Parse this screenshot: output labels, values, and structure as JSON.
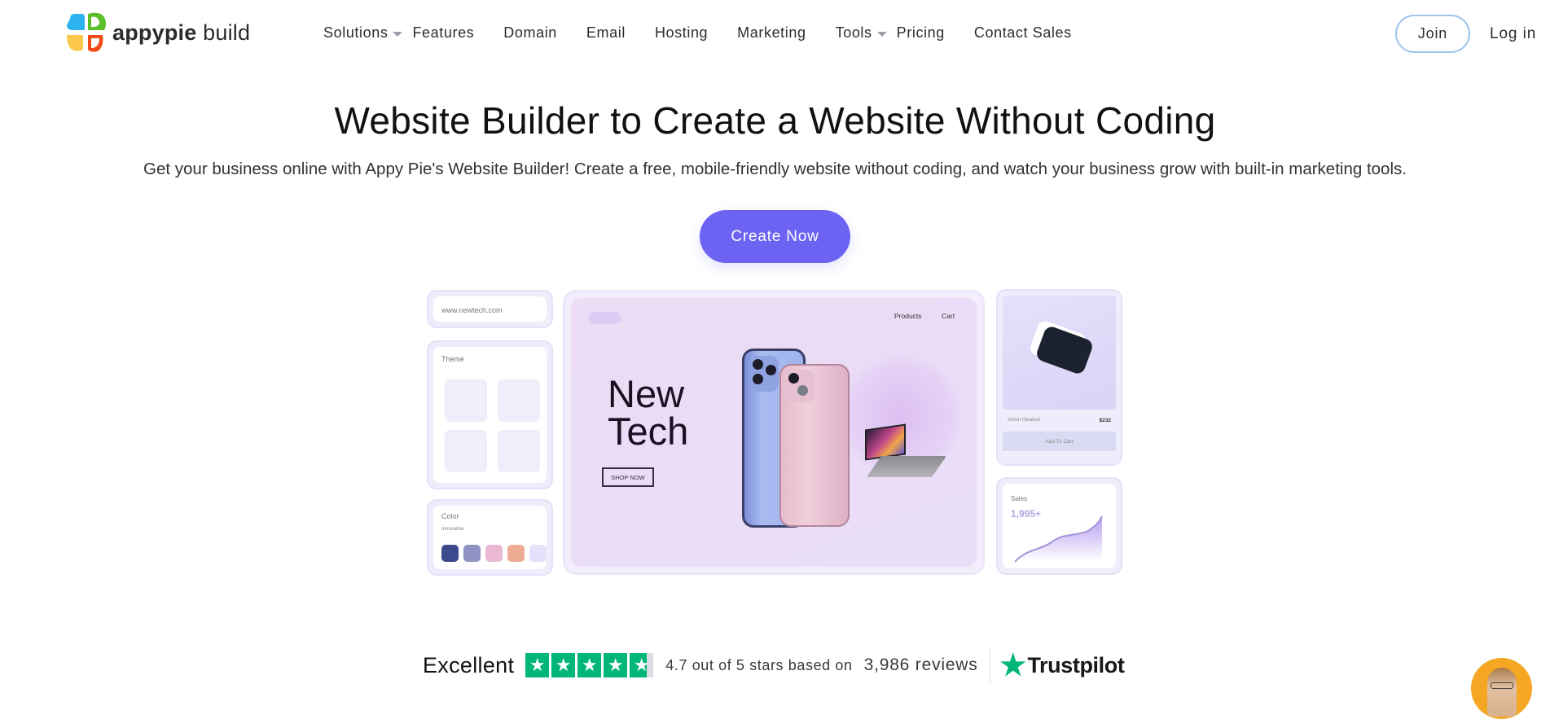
{
  "header": {
    "logo": {
      "brand_bold": "appypie",
      "brand_light": "build",
      "icon": "appypie-logo-icon"
    },
    "nav": [
      {
        "label": "Solutions",
        "has_dropdown": true
      },
      {
        "label": "Features",
        "has_dropdown": false
      },
      {
        "label": "Domain",
        "has_dropdown": false
      },
      {
        "label": "Email",
        "has_dropdown": false
      },
      {
        "label": "Hosting",
        "has_dropdown": false
      },
      {
        "label": "Marketing",
        "has_dropdown": false
      },
      {
        "label": "Tools",
        "has_dropdown": true
      },
      {
        "label": "Pricing",
        "has_dropdown": false
      },
      {
        "label": "Contact Sales",
        "has_dropdown": false
      }
    ],
    "join_label": "Join",
    "login_label": "Log in"
  },
  "hero": {
    "title": "Website Builder to Create a Website Without Coding",
    "subtitle": "Get your business online with Appy Pie's Website Builder! Create a free, mobile-friendly website without coding, and watch your business grow with built-in marketing tools.",
    "cta_label": "Create Now",
    "accent_color": "#6c63f2"
  },
  "mockup": {
    "url": "www.newtech.com",
    "theme_label": "Theme",
    "color_label": "Color",
    "color_scheme_name": "Innovative",
    "swatches": [
      "#3b4a8c",
      "#8f93c3",
      "#eab8d3",
      "#eeab94",
      "#e5e1fb"
    ],
    "site": {
      "nav": [
        "Products",
        "Cart"
      ],
      "headline_line1": "New",
      "headline_line2": "Tech",
      "button": "SHOP NOW"
    },
    "product": {
      "name": "Vision Headset",
      "price": "$232",
      "button": "Add To Cart"
    },
    "sales": {
      "label": "Sales",
      "value": "1,995+"
    }
  },
  "reviews": {
    "label": "Excellent",
    "rating": 4.7,
    "max_rating": 5,
    "rating_text": "4.7 out of 5 stars based on",
    "count_text": "3,986 reviews",
    "brand": "Trustpilot",
    "star_color": "#00b67a"
  }
}
